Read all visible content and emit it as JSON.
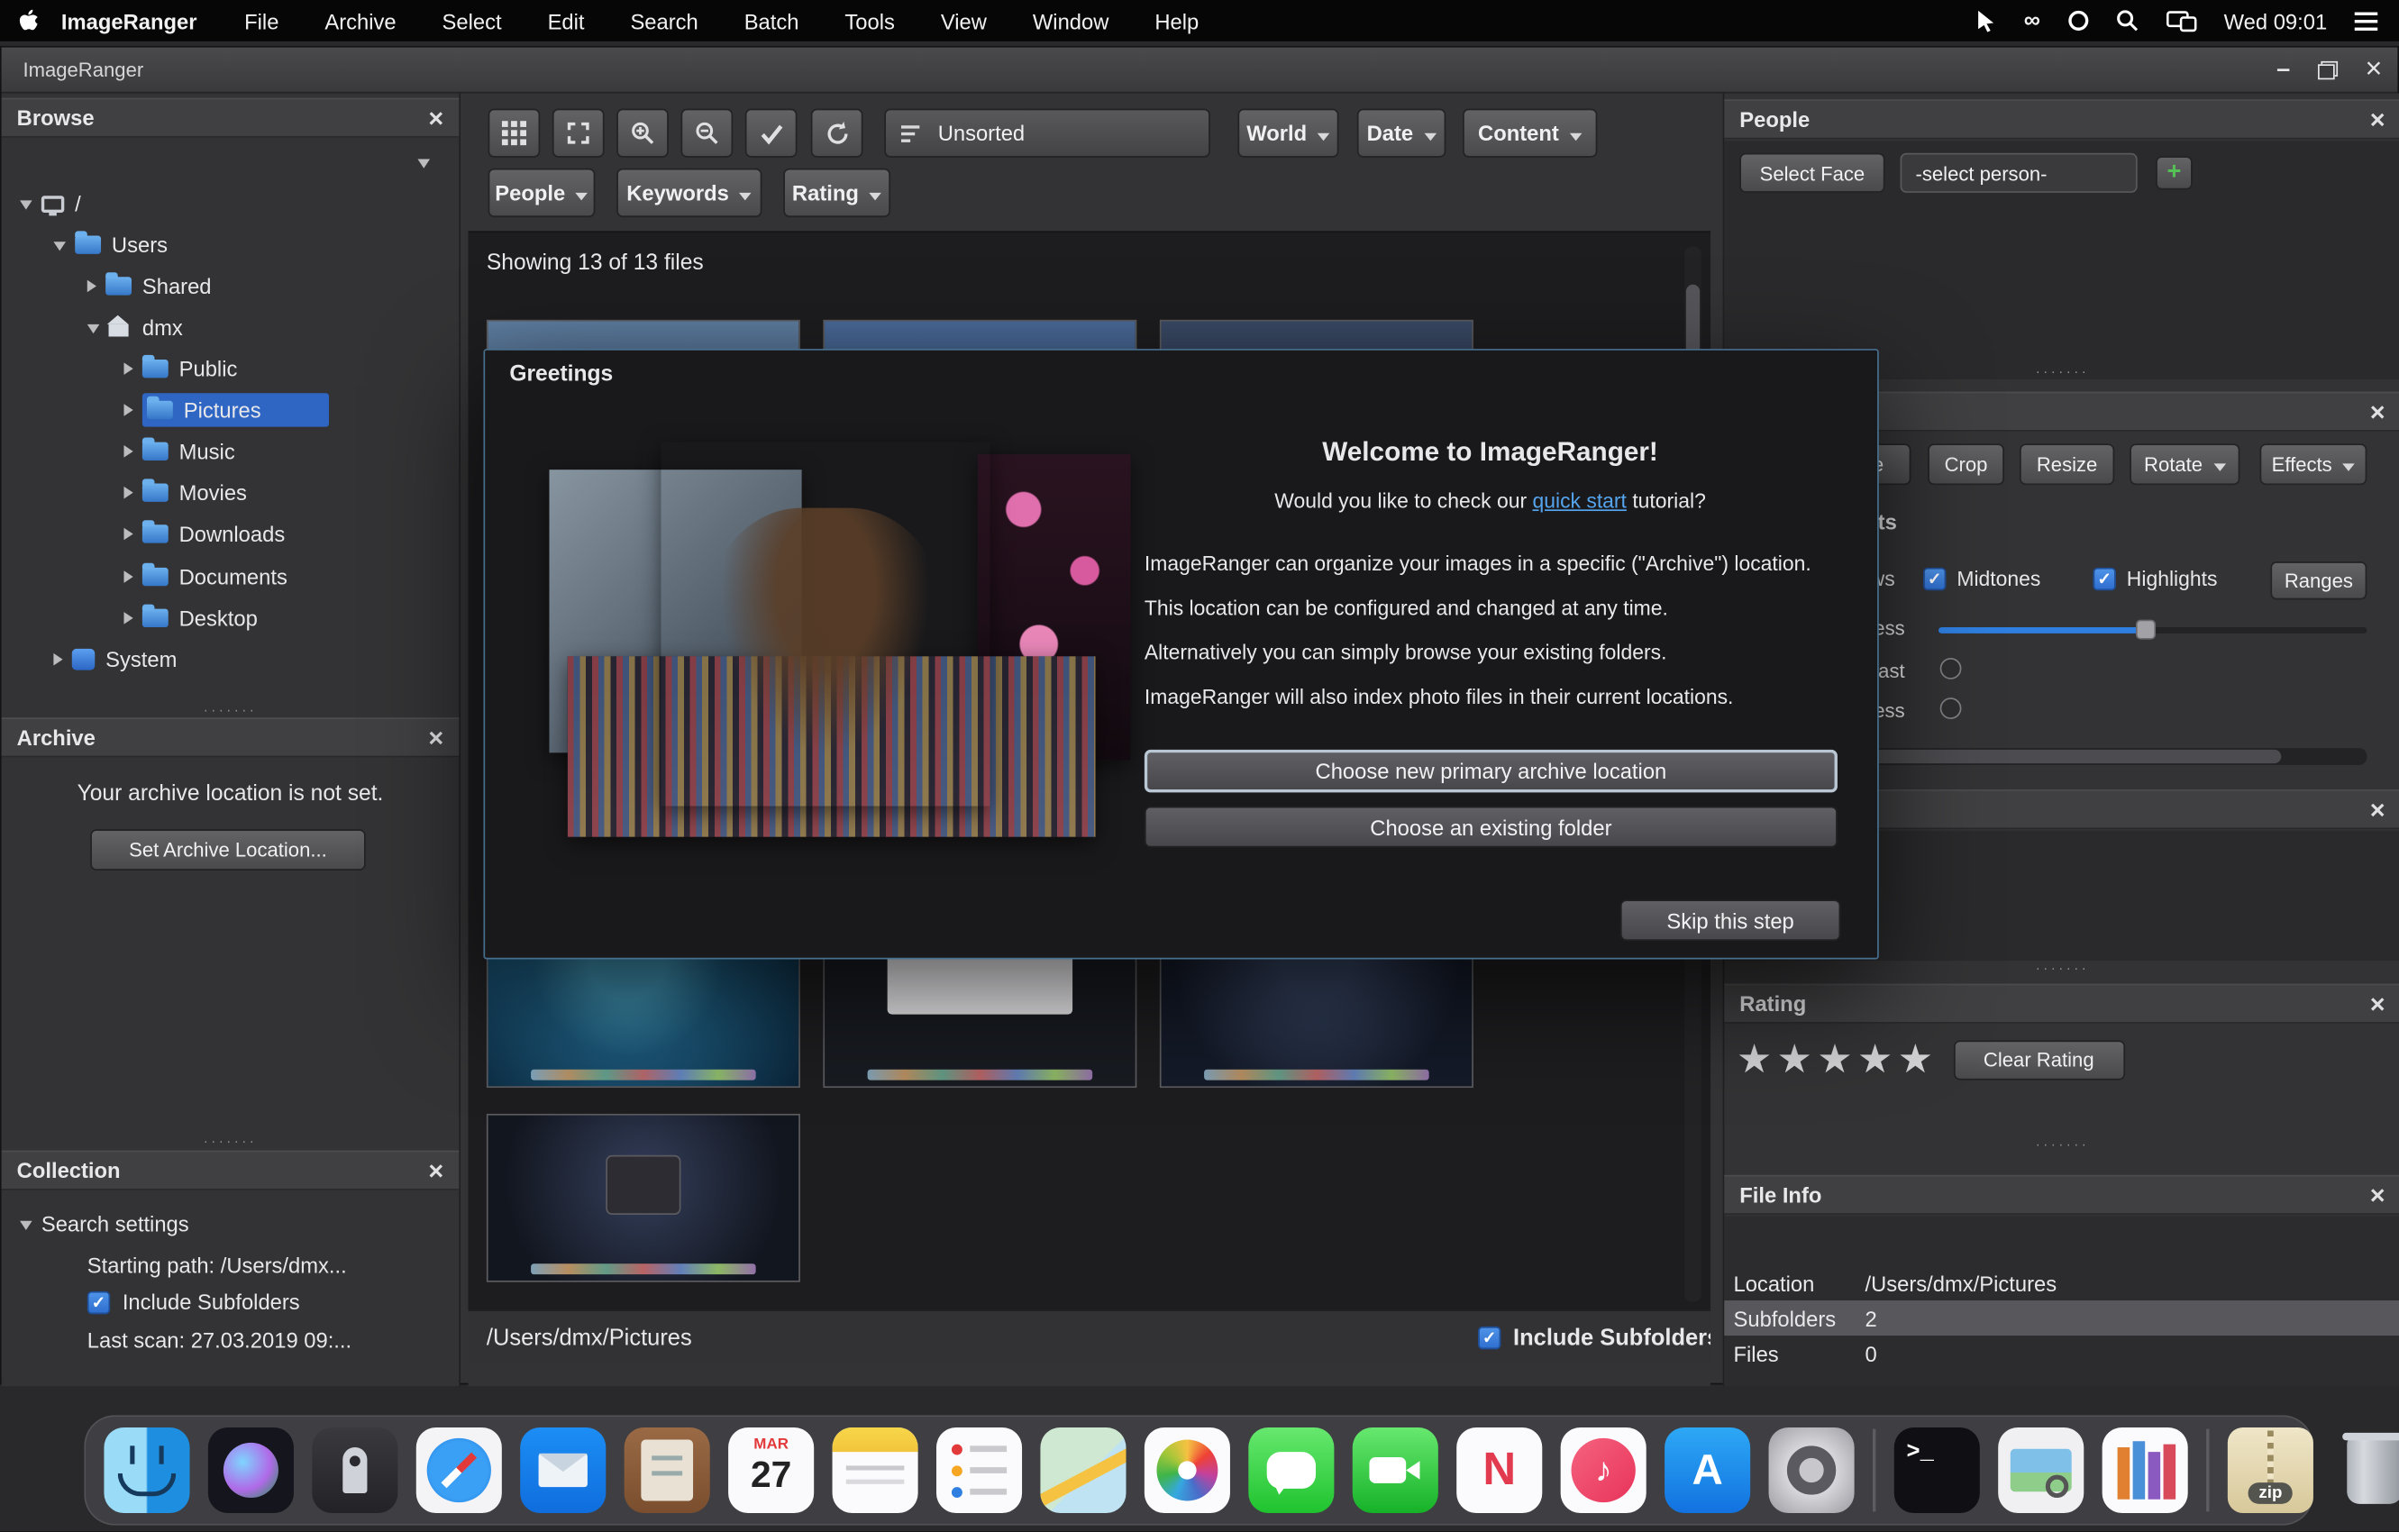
{
  "icons": {
    "check": "✓",
    "star": "★",
    "close": "×",
    "minimize": "–",
    "dots": "·······",
    "infinity": "∞"
  },
  "menubar": {
    "app_name": "ImageRanger",
    "items": [
      "File",
      "Archive",
      "Select",
      "Edit",
      "Search",
      "Batch",
      "Tools",
      "View",
      "Window",
      "Help"
    ],
    "clock": "Wed 09:01"
  },
  "window": {
    "title": "ImageRanger"
  },
  "browse_panel": {
    "title": "Browse",
    "tree": [
      {
        "label": "/"
      },
      {
        "label": "Users"
      },
      {
        "label": "Shared"
      },
      {
        "label": "dmx"
      },
      {
        "label": "Public"
      },
      {
        "label": "Pictures"
      },
      {
        "label": "Music"
      },
      {
        "label": "Movies"
      },
      {
        "label": "Downloads"
      },
      {
        "label": "Documents"
      },
      {
        "label": "Desktop"
      },
      {
        "label": "System"
      }
    ]
  },
  "archive_panel": {
    "title": "Archive",
    "message": "Your archive location is not set.",
    "button": "Set Archive Location..."
  },
  "collection_panel": {
    "title": "Collection",
    "root": "Search settings",
    "items": [
      "Starting path: /Users/dmx...",
      "Include Subfolders",
      "Last scan: 27.03.2019 09:..."
    ]
  },
  "toolbar": {
    "sort_value": "Unsorted",
    "filters": [
      "World",
      "Date",
      "Content"
    ],
    "filters2": [
      "People",
      "Keywords",
      "Rating"
    ]
  },
  "browser": {
    "status": "Showing 13 of 13 files",
    "path": "/Users/dmx/Pictures",
    "include_label": "Include Subfolders"
  },
  "dialog": {
    "title": "Greetings",
    "heading": "Welcome to ImageRanger!",
    "tutorial_prefix": "Would you like to check our ",
    "tutorial_link": "quick start",
    "tutorial_suffix": " tutorial?",
    "lines": [
      "ImageRanger can organize your images in a specific (\"Archive\") location.",
      "This location can be configured and changed at any time.",
      "Alternatively you can simply browse your existing folders.",
      "ImageRanger will also index photo files in their current locations."
    ],
    "primary_button": "Choose new primary archive location",
    "secondary_button": "Choose an existing folder",
    "skip_button": "Skip this step"
  },
  "people_panel": {
    "title": "People",
    "select_face": "Select Face",
    "person_dropdown": "-select person-",
    "add_label": "+"
  },
  "edit_panel": {
    "buttons": [
      "Enhance",
      "Crop",
      "Resize",
      "Rotate",
      "Effects"
    ],
    "tab_label": "Adjustments",
    "checkboxes": [
      "Shadows",
      "Midtones",
      "Highlights"
    ],
    "ranges_label": "Ranges",
    "sliders": [
      "Brightness",
      "Contrast",
      "Sharpness"
    ]
  },
  "rating_panel": {
    "title": "Rating",
    "clear_label": "Clear Rating"
  },
  "fileinfo_panel": {
    "title": "File Info",
    "rows": [
      {
        "key": "Location",
        "value": "/Users/dmx/Pictures"
      },
      {
        "key": "Subfolders",
        "value": "2"
      },
      {
        "key": "Files",
        "value": "0"
      }
    ]
  },
  "dock": {
    "calendar_month": "MAR",
    "calendar_day": "27",
    "zip_label": "zip",
    "terminal_glyph": ">_",
    "music_glyph": "♪",
    "news_glyph": "N",
    "appstore_glyph": "A"
  }
}
